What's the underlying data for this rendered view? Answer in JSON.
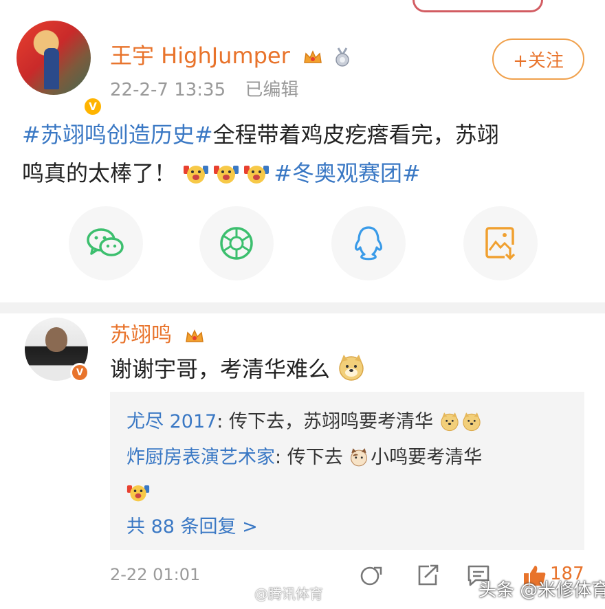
{
  "post": {
    "author": "王宇 HighJumper",
    "date": "22-2-7 13:35",
    "edited": "已编辑",
    "follow_label": "+关注",
    "text": {
      "tag1": "#苏翊鸣创造历史#",
      "line1_rest": "全程带着鸡皮疙瘩看完，苏翊",
      "line2": "鸣真的太棒了！",
      "tag2": "#冬奥观赛团#"
    },
    "share": [
      {
        "icon": "wechat-icon",
        "color": "#3cbf6e"
      },
      {
        "icon": "moments-icon",
        "color": "#3cbf6e"
      },
      {
        "icon": "qq-icon",
        "color": "#3a9be8"
      },
      {
        "icon": "save-image-icon",
        "color": "#f0a030"
      }
    ]
  },
  "comment": {
    "author": "苏翊鸣",
    "text": "谢谢宇哥，考清华难么",
    "replies": [
      {
        "who": "尤尽 2017",
        "sep": ":",
        "text": " 传下去，苏翊鸣要考清华"
      },
      {
        "who": "炸厨房表演艺术家",
        "sep": ":",
        "text_a": " 传下去",
        "text_b": "小鸣要考清华"
      }
    ],
    "more_replies": "共 88 条回复 >",
    "time": "2-22 01:01",
    "like_count": "187"
  },
  "watermarks": {
    "weibo": "@腾讯体育",
    "toutiao": "头条 @米修体育"
  },
  "colors": {
    "orange": "#e8732b",
    "link_blue": "#3a78c4",
    "meta_gray": "#9a9a9a"
  }
}
